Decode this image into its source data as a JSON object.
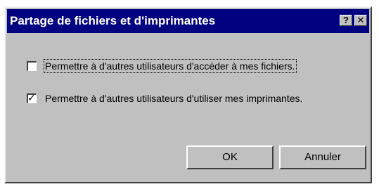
{
  "window": {
    "title": "Partage de fichiers et d'imprimantes",
    "help_label": "?",
    "close_label": "✕"
  },
  "options": [
    {
      "label": "Permettre à d'autres utilisateurs d'accéder à mes fichiers.",
      "checked": false,
      "mark": ""
    },
    {
      "label": "Permettre à d'autres utilisateurs d'utiliser mes imprimantes.",
      "checked": true,
      "mark": "✓"
    }
  ],
  "buttons": {
    "ok_label": "OK",
    "cancel_label": "Annuler"
  },
  "colors": {
    "titlebar": "#000080",
    "dialog_face": "#c0c0c0"
  }
}
